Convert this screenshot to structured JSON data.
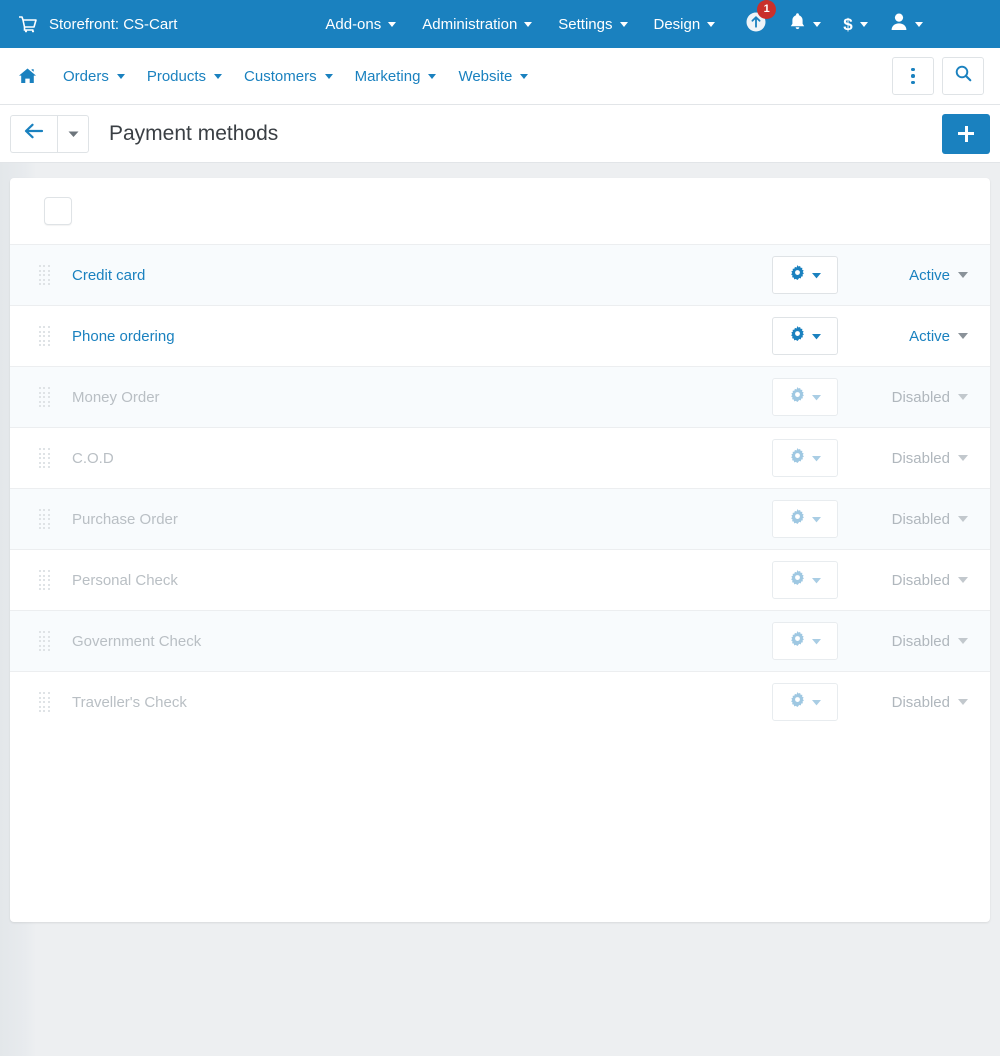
{
  "topbar": {
    "cart_icon": "shopping-cart-icon",
    "brand": "Storefront: CS-Cart",
    "nav": [
      {
        "label": "Add-ons"
      },
      {
        "label": "Administration"
      },
      {
        "label": "Settings"
      },
      {
        "label": "Design"
      }
    ],
    "right": {
      "upgrade_icon": "upgrade-center-icon",
      "upgrade_badge": "1",
      "notifications_icon": "bell-icon",
      "currency_icon": "dollar-icon",
      "currency_symbol": "$",
      "account_icon": "user-icon"
    }
  },
  "subnav": {
    "home_icon": "home-icon",
    "items": [
      {
        "label": "Orders"
      },
      {
        "label": "Products"
      },
      {
        "label": "Customers"
      },
      {
        "label": "Marketing"
      },
      {
        "label": "Website"
      }
    ],
    "more_icon": "kebab-menu-icon",
    "search_icon": "search-icon"
  },
  "page_header": {
    "back_icon": "arrow-left-icon",
    "back_dropdown_icon": "chevron-down-icon",
    "title": "Payment methods",
    "add_icon": "plus-icon"
  },
  "list": {
    "select_all_checked": false,
    "drag_icon": "drag-handle-icon",
    "gear_icon": "gear-icon",
    "dropdown_icon": "chevron-down-icon",
    "rows": [
      {
        "name": "Credit card",
        "status": "Active",
        "enabled": true
      },
      {
        "name": "Phone ordering",
        "status": "Active",
        "enabled": true
      },
      {
        "name": "Money Order",
        "status": "Disabled",
        "enabled": false
      },
      {
        "name": "C.O.D",
        "status": "Disabled",
        "enabled": false
      },
      {
        "name": "Purchase Order",
        "status": "Disabled",
        "enabled": false
      },
      {
        "name": "Personal Check",
        "status": "Disabled",
        "enabled": false
      },
      {
        "name": "Government Check",
        "status": "Disabled",
        "enabled": false
      },
      {
        "name": "Traveller's Check",
        "status": "Disabled",
        "enabled": false
      }
    ]
  },
  "colors": {
    "brand_blue": "#1a81bf",
    "badge_red": "#c9302c",
    "page_bg": "#edeff1",
    "stripe": "#f8fbfd",
    "muted": "#b9bfc4"
  }
}
